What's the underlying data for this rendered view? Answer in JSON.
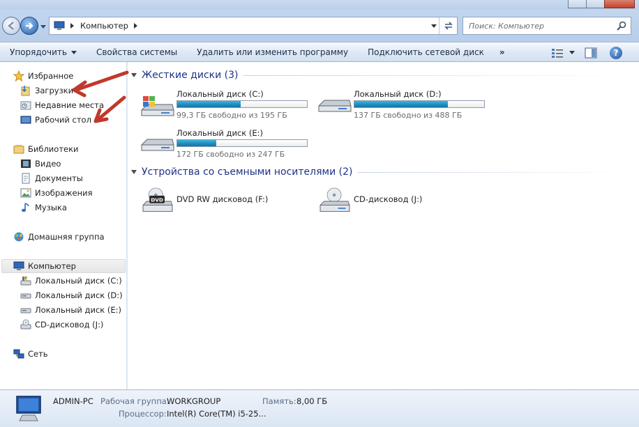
{
  "address": {
    "breadcrumb": "Компьютер",
    "search_placeholder": "Поиск: Компьютер"
  },
  "toolbar": {
    "organize": "Упорядочить",
    "system_properties": "Свойства системы",
    "uninstall": "Удалить или изменить программу",
    "map_drive": "Подключить сетевой диск",
    "more": "»",
    "help": "?"
  },
  "nav": {
    "favorites": "Избранное",
    "downloads": "Загрузки",
    "recent": "Недавние места",
    "desktop": "Рабочий стол",
    "libraries": "Библиотеки",
    "video": "Видео",
    "documents": "Документы",
    "images": "Изображения",
    "music": "Музыка",
    "homegroup": "Домашняя группа",
    "computer": "Компьютер",
    "disk_c": "Локальный диск (C:)",
    "disk_d": "Локальный диск (D:)",
    "disk_e": "Локальный диск (E:)",
    "cd_j": "CD-дисковод (J:)",
    "network": "Сеть"
  },
  "content": {
    "hard_disks_header": "Жесткие диски (3)",
    "removable_header": "Устройства со съемными носителями (2)",
    "drives": [
      {
        "name": "Локальный диск (C:)",
        "free": "99,3 ГБ свободно из 195 ГБ",
        "used_fraction": 0.49
      },
      {
        "name": "Локальный диск (D:)",
        "free": "137 ГБ свободно из 488 ГБ",
        "used_fraction": 0.72
      },
      {
        "name": "Локальный диск (E:)",
        "free": "172 ГБ свободно из 247 ГБ",
        "used_fraction": 0.3
      }
    ],
    "removable": [
      {
        "name": "DVD RW дисковод (F:)",
        "icon_label": "DVD"
      },
      {
        "name": "CD-дисковод (J:)"
      }
    ]
  },
  "details": {
    "pc_name": "ADMIN-PC",
    "workgroup_label": "Рабочая группа:",
    "workgroup_value": "WORKGROUP",
    "memory_label": "Память:",
    "memory_value": "8,00 ГБ",
    "cpu_label": "Процессор:",
    "cpu_value": "Intel(R) Core(TM) i5-25..."
  },
  "colors": {
    "accent_header": "#1e3287",
    "bar_fill": "#1e8fc0",
    "annotation": "#c0392b"
  }
}
